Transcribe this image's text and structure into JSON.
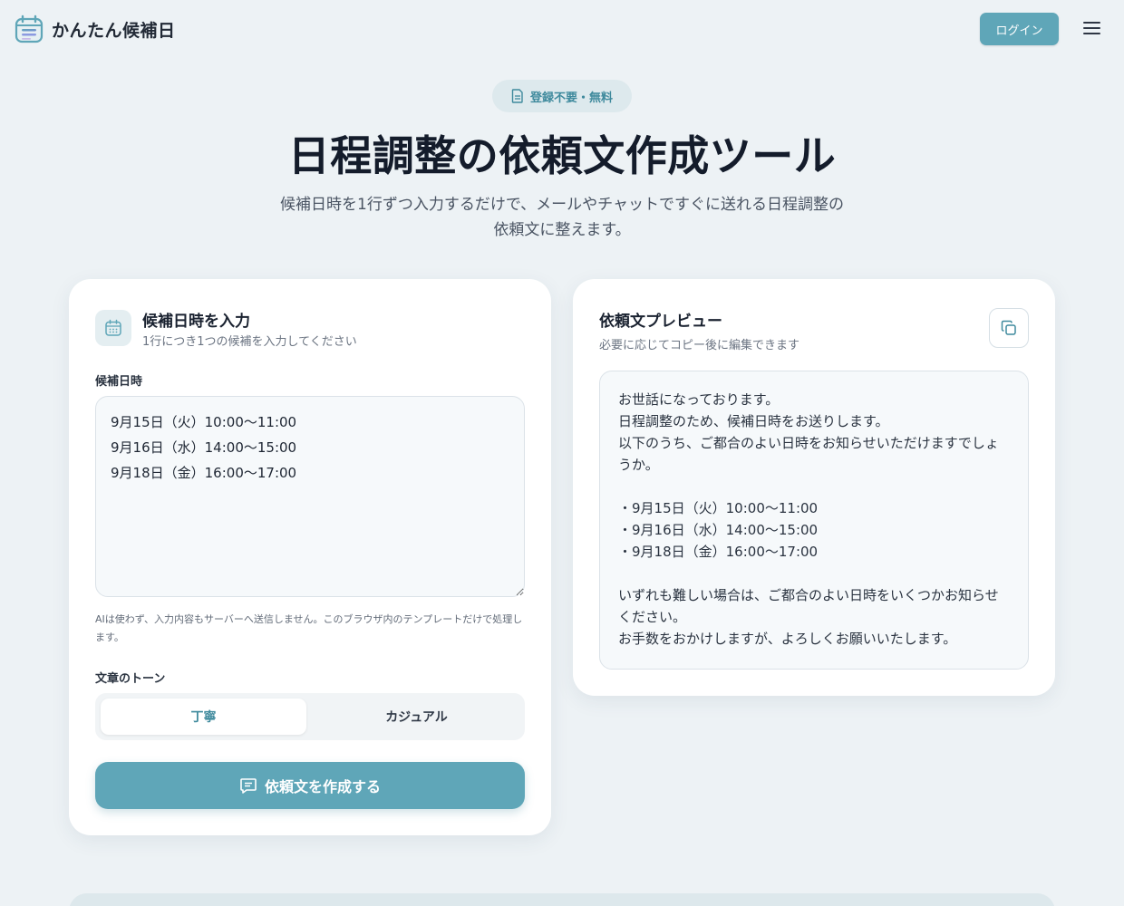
{
  "header": {
    "logo_text": "かんたん候補日",
    "login_label": "ログイン"
  },
  "hero": {
    "badge": "登録不要・無料",
    "title": "日程調整の依頼文作成ツール",
    "subtitle_line1": "候補日時を1行ずつ入力するだけで、メールやチャットですぐに送れる日程調整の",
    "subtitle_line2": "依頼文に整えます。"
  },
  "input_card": {
    "title": "候補日時を入力",
    "subtitle": "1行につき1つの候補を入力してください",
    "field_label": "候補日時",
    "textarea_value": "9月15日（火）10:00〜11:00\n9月16日（水）14:00〜15:00\n9月18日（金）16:00〜17:00",
    "note": "AIは使わず、入力内容もサーバーへ送信しません。このブラウザ内のテンプレートだけで処理します。",
    "tone_label": "文章のトーン",
    "tone_options": [
      "丁寧",
      "カジュアル"
    ],
    "tone_selected": "丁寧",
    "create_label": "依頼文を作成する"
  },
  "preview_card": {
    "title": "依頼文プレビュー",
    "subtitle": "必要に応じてコピー後に編集できます",
    "lines": [
      "お世話になっております。",
      "日程調整のため、候補日時をお送りします。",
      "以下のうち、ご都合のよい日時をお知らせいただけますでしょうか。",
      "",
      "・9月15日（火）10:00〜11:00",
      "・9月16日（水）14:00〜15:00",
      "・9月18日（金）16:00〜17:00",
      "",
      "いずれも難しい場合は、ご都合のよい日時をいくつかお知らせください。",
      "お手数をおかけしますが、よろしくお願いいたします。"
    ]
  },
  "colors": {
    "accent": "#5fa6b8",
    "accent_text": "#3f8a9d",
    "page_bg": "#edf2f5"
  },
  "icons": {
    "logo": "calendar-icon",
    "badge": "document-icon",
    "input_card": "calendar-icon",
    "copy": "copy-icon",
    "create": "message-icon",
    "menu": "hamburger-menu-icon"
  }
}
